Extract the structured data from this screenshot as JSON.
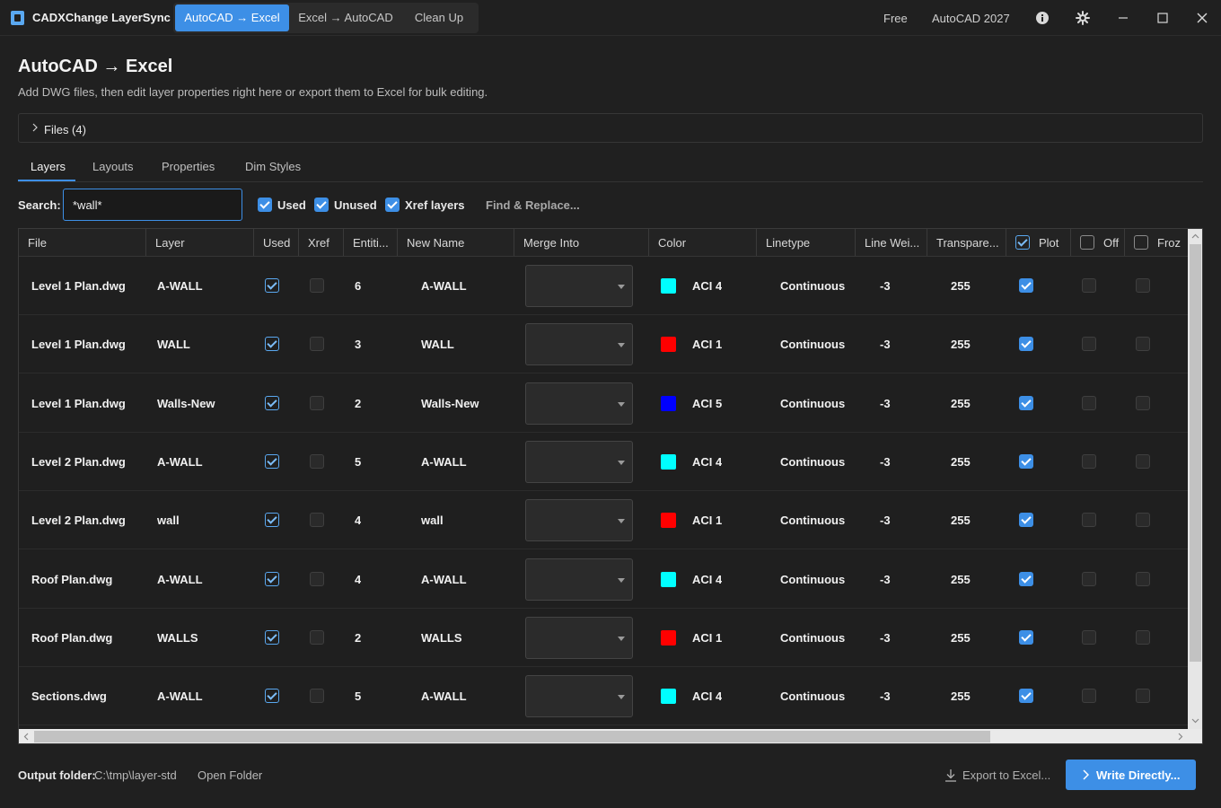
{
  "titlebar": {
    "app_title": "CADXChange LayerSync",
    "modes": [
      "AutoCAD → Excel",
      "Excel → AutoCAD",
      "Clean Up"
    ],
    "plan": "Free",
    "version": "AutoCAD 2027",
    "icons": [
      "info-icon",
      "settings-icon",
      "minimize-icon",
      "maximize-icon",
      "close-icon"
    ]
  },
  "page": {
    "title": "AutoCAD → Excel",
    "subtitle": "Add DWG files, then edit layer properties right here or export them to Excel for bulk editing."
  },
  "files": {
    "label": "Files (4)"
  },
  "tabs": [
    "Layers",
    "Layouts",
    "Properties",
    "Dim Styles"
  ],
  "search": {
    "label": "Search:",
    "value": "*wall*",
    "filters": [
      {
        "label": "Used",
        "checked": true
      },
      {
        "label": "Unused",
        "checked": true
      },
      {
        "label": "Xref layers",
        "checked": true
      }
    ],
    "find_replace": "Find & Replace..."
  },
  "grid": {
    "columns": [
      "File",
      "Layer",
      "Used",
      "Xref",
      "Entiti...",
      "New Name",
      "Merge Into",
      "Color",
      "Linetype",
      "Line Wei...",
      "Transpare...",
      "Plot",
      "Off",
      "Froz"
    ],
    "rows": [
      {
        "file": "Level 1 Plan.dwg",
        "layer": "A-WALL",
        "used": true,
        "xref": false,
        "entities": "6",
        "new_name": "A-WALL",
        "merge_into": "",
        "color_hex": "#00ffff",
        "color": "ACI 4",
        "linetype": "Continuous",
        "lineweight": "-3",
        "transparency": "255",
        "plot": true,
        "off": false,
        "frozen": false
      },
      {
        "file": "Level 1 Plan.dwg",
        "layer": "WALL",
        "used": true,
        "xref": false,
        "entities": "3",
        "new_name": "WALL",
        "merge_into": "",
        "color_hex": "#ff0000",
        "color": "ACI 1",
        "linetype": "Continuous",
        "lineweight": "-3",
        "transparency": "255",
        "plot": true,
        "off": false,
        "frozen": false
      },
      {
        "file": "Level 1 Plan.dwg",
        "layer": "Walls-New",
        "used": true,
        "xref": false,
        "entities": "2",
        "new_name": "Walls-New",
        "merge_into": "",
        "color_hex": "#0000ff",
        "color": "ACI 5",
        "linetype": "Continuous",
        "lineweight": "-3",
        "transparency": "255",
        "plot": true,
        "off": false,
        "frozen": false
      },
      {
        "file": "Level 2 Plan.dwg",
        "layer": "A-WALL",
        "used": true,
        "xref": false,
        "entities": "5",
        "new_name": "A-WALL",
        "merge_into": "",
        "color_hex": "#00ffff",
        "color": "ACI 4",
        "linetype": "Continuous",
        "lineweight": "-3",
        "transparency": "255",
        "plot": true,
        "off": false,
        "frozen": false
      },
      {
        "file": "Level 2 Plan.dwg",
        "layer": "wall",
        "used": true,
        "xref": false,
        "entities": "4",
        "new_name": "wall",
        "merge_into": "",
        "color_hex": "#ff0000",
        "color": "ACI 1",
        "linetype": "Continuous",
        "lineweight": "-3",
        "transparency": "255",
        "plot": true,
        "off": false,
        "frozen": false
      },
      {
        "file": "Roof Plan.dwg",
        "layer": "A-WALL",
        "used": true,
        "xref": false,
        "entities": "4",
        "new_name": "A-WALL",
        "merge_into": "",
        "color_hex": "#00ffff",
        "color": "ACI 4",
        "linetype": "Continuous",
        "lineweight": "-3",
        "transparency": "255",
        "plot": true,
        "off": false,
        "frozen": false
      },
      {
        "file": "Roof Plan.dwg",
        "layer": "WALLS",
        "used": true,
        "xref": false,
        "entities": "2",
        "new_name": "WALLS",
        "merge_into": "",
        "color_hex": "#ff0000",
        "color": "ACI 1",
        "linetype": "Continuous",
        "lineweight": "-3",
        "transparency": "255",
        "plot": true,
        "off": false,
        "frozen": false
      },
      {
        "file": "Sections.dwg",
        "layer": "A-WALL",
        "used": true,
        "xref": false,
        "entities": "5",
        "new_name": "A-WALL",
        "merge_into": "",
        "color_hex": "#00ffff",
        "color": "ACI 4",
        "linetype": "Continuous",
        "lineweight": "-3",
        "transparency": "255",
        "plot": true,
        "off": false,
        "frozen": false
      }
    ]
  },
  "footer": {
    "output_label": "Output folder:",
    "output_path": "C:\\tmp\\layer-std",
    "open_folder": "Open Folder",
    "export_label": "Export to Excel...",
    "write_label": "Write Directly..."
  },
  "colors": {
    "accent": "#3d8fe6",
    "background": "#202020"
  }
}
